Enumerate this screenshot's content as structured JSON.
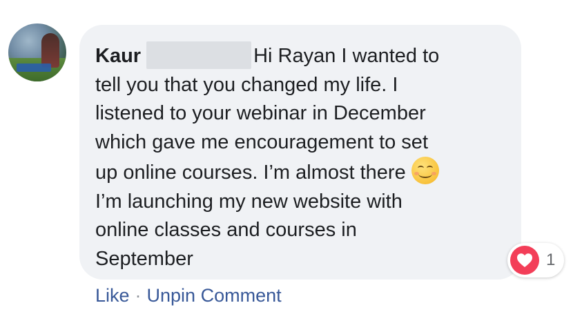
{
  "comment": {
    "author": "Kaur",
    "text_lines": [
      "Hi Rayan I wanted to",
      "tell you that you changed my life. I",
      "listened to your webinar in December",
      "which gave me encouragement to set",
      "up online courses. I’m almost there",
      "I’m launching my new website with",
      "online classes and courses in",
      "September"
    ],
    "emoji": "smiling-face-icon"
  },
  "reaction": {
    "icon": "heart-icon",
    "color": "#f33e58",
    "count": "1"
  },
  "actions": {
    "like": "Like",
    "separator": "·",
    "unpin": "Unpin Comment"
  },
  "colors": {
    "bubble": "#f0f2f5",
    "link": "#385898"
  }
}
